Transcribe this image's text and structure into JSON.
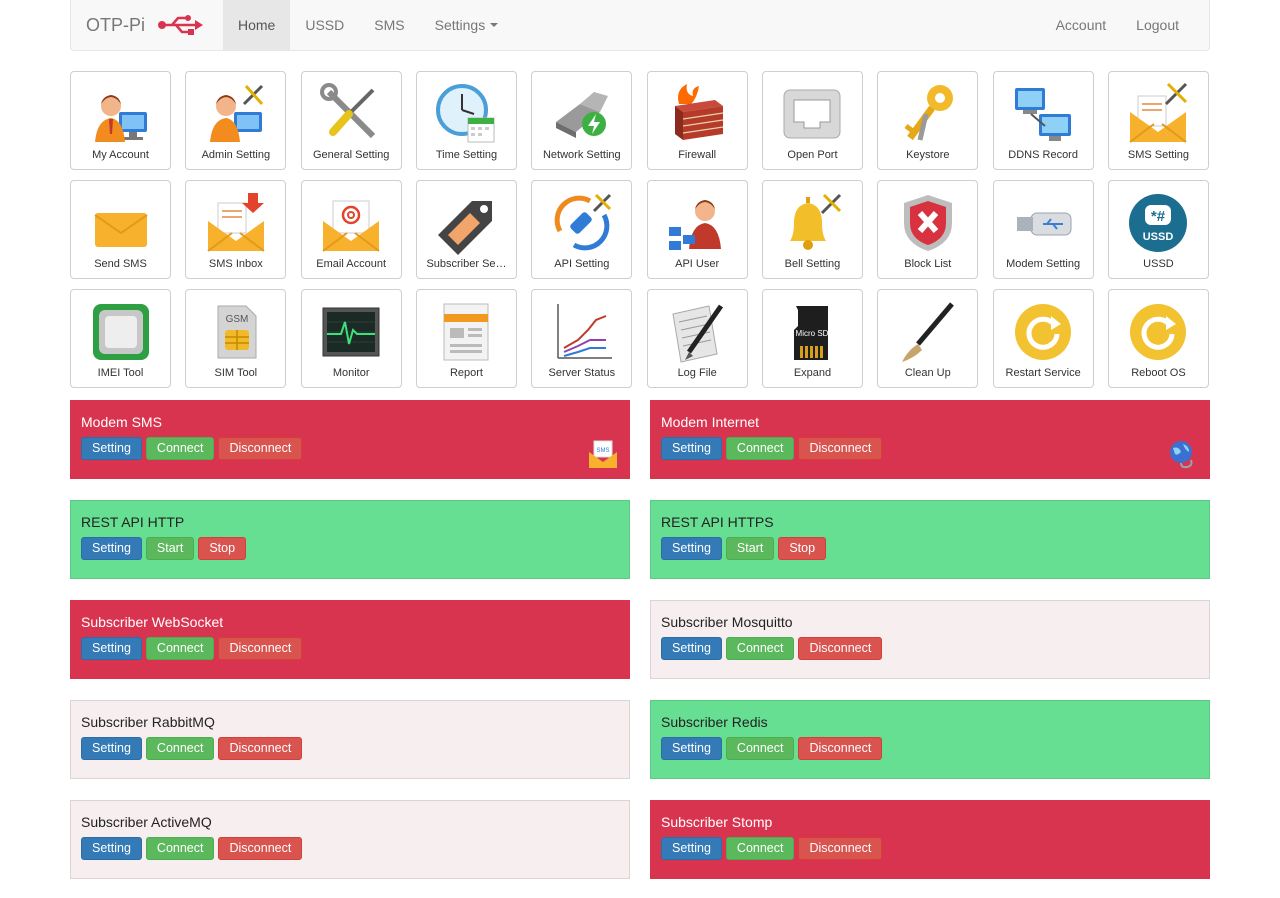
{
  "navbar": {
    "brand": "OTP-Pi",
    "links": [
      "Home",
      "USSD",
      "SMS",
      "Settings"
    ],
    "active": "Home",
    "right_links": [
      "Account",
      "Logout"
    ]
  },
  "tiles": [
    {
      "label": "My Account",
      "icon": "user-computer-icon"
    },
    {
      "label": "Admin Setting",
      "icon": "admin-tools-icon"
    },
    {
      "label": "General Setting",
      "icon": "wrench-screwdriver-icon"
    },
    {
      "label": "Time Setting",
      "icon": "clock-calendar-icon"
    },
    {
      "label": "Network Setting",
      "icon": "network-plug-icon"
    },
    {
      "label": "Firewall",
      "icon": "firewall-icon"
    },
    {
      "label": "Open Port",
      "icon": "ethernet-port-icon"
    },
    {
      "label": "Keystore",
      "icon": "keys-icon"
    },
    {
      "label": "DDNS Record",
      "icon": "networked-computers-icon"
    },
    {
      "label": "SMS Setting",
      "icon": "envelope-tools-icon"
    },
    {
      "label": "Send SMS",
      "icon": "envelope-icon"
    },
    {
      "label": "SMS Inbox",
      "icon": "envelope-inbox-icon"
    },
    {
      "label": "Email Account",
      "icon": "email-at-icon"
    },
    {
      "label": "Subscriber Se…",
      "icon": "tag-icon"
    },
    {
      "label": "API Setting",
      "icon": "api-plug-icon"
    },
    {
      "label": "API User",
      "icon": "api-user-icon"
    },
    {
      "label": "Bell Setting",
      "icon": "bell-tools-icon"
    },
    {
      "label": "Block List",
      "icon": "shield-block-icon"
    },
    {
      "label": "Modem Setting",
      "icon": "usb-modem-icon"
    },
    {
      "label": "USSD",
      "icon": "ussd-icon"
    },
    {
      "label": "IMEI Tool",
      "icon": "chip-icon"
    },
    {
      "label": "SIM Tool",
      "icon": "sim-card-icon"
    },
    {
      "label": "Monitor",
      "icon": "monitor-pulse-icon"
    },
    {
      "label": "Report",
      "icon": "report-icon"
    },
    {
      "label": "Server Status",
      "icon": "line-chart-icon"
    },
    {
      "label": "Log File",
      "icon": "log-pen-icon"
    },
    {
      "label": "Expand",
      "icon": "microsd-icon"
    },
    {
      "label": "Clean Up",
      "icon": "brush-icon"
    },
    {
      "label": "Restart Service",
      "icon": "restart-icon"
    },
    {
      "label": "Reboot OS",
      "icon": "reboot-icon"
    }
  ],
  "sim_text": "GSM",
  "ussd_text": "USSD",
  "sd_text": "Micro SD",
  "panels": [
    {
      "title": "Modem SMS",
      "status": "red",
      "buttons": [
        "Setting",
        "Connect",
        "Disconnect"
      ],
      "icon": "sms-envelope-icon",
      "icon_text": "SMS"
    },
    {
      "title": "Modem Internet",
      "status": "red",
      "buttons": [
        "Setting",
        "Connect",
        "Disconnect"
      ],
      "icon": "globe-cable-icon"
    },
    {
      "title": "REST API HTTP",
      "status": "green",
      "buttons": [
        "Setting",
        "Start",
        "Stop"
      ]
    },
    {
      "title": "REST API HTTPS",
      "status": "green",
      "buttons": [
        "Setting",
        "Start",
        "Stop"
      ]
    },
    {
      "title": "Subscriber WebSocket",
      "status": "red",
      "buttons": [
        "Setting",
        "Connect",
        "Disconnect"
      ]
    },
    {
      "title": "Subscriber Mosquitto",
      "status": "neutral",
      "buttons": [
        "Setting",
        "Connect",
        "Disconnect"
      ]
    },
    {
      "title": "Subscriber RabbitMQ",
      "status": "neutral",
      "buttons": [
        "Setting",
        "Connect",
        "Disconnect"
      ]
    },
    {
      "title": "Subscriber Redis",
      "status": "green",
      "buttons": [
        "Setting",
        "Connect",
        "Disconnect"
      ]
    },
    {
      "title": "Subscriber ActiveMQ",
      "status": "neutral",
      "buttons": [
        "Setting",
        "Connect",
        "Disconnect"
      ]
    },
    {
      "title": "Subscriber Stomp",
      "status": "red",
      "buttons": [
        "Setting",
        "Connect",
        "Disconnect"
      ]
    }
  ],
  "colors": {
    "panel_red": "#d9344f",
    "panel_green": "#67df92",
    "panel_neutral": "#f7efef",
    "btn_primary": "#337ab7",
    "btn_success": "#5cb85c",
    "btn_danger": "#d9534f"
  }
}
